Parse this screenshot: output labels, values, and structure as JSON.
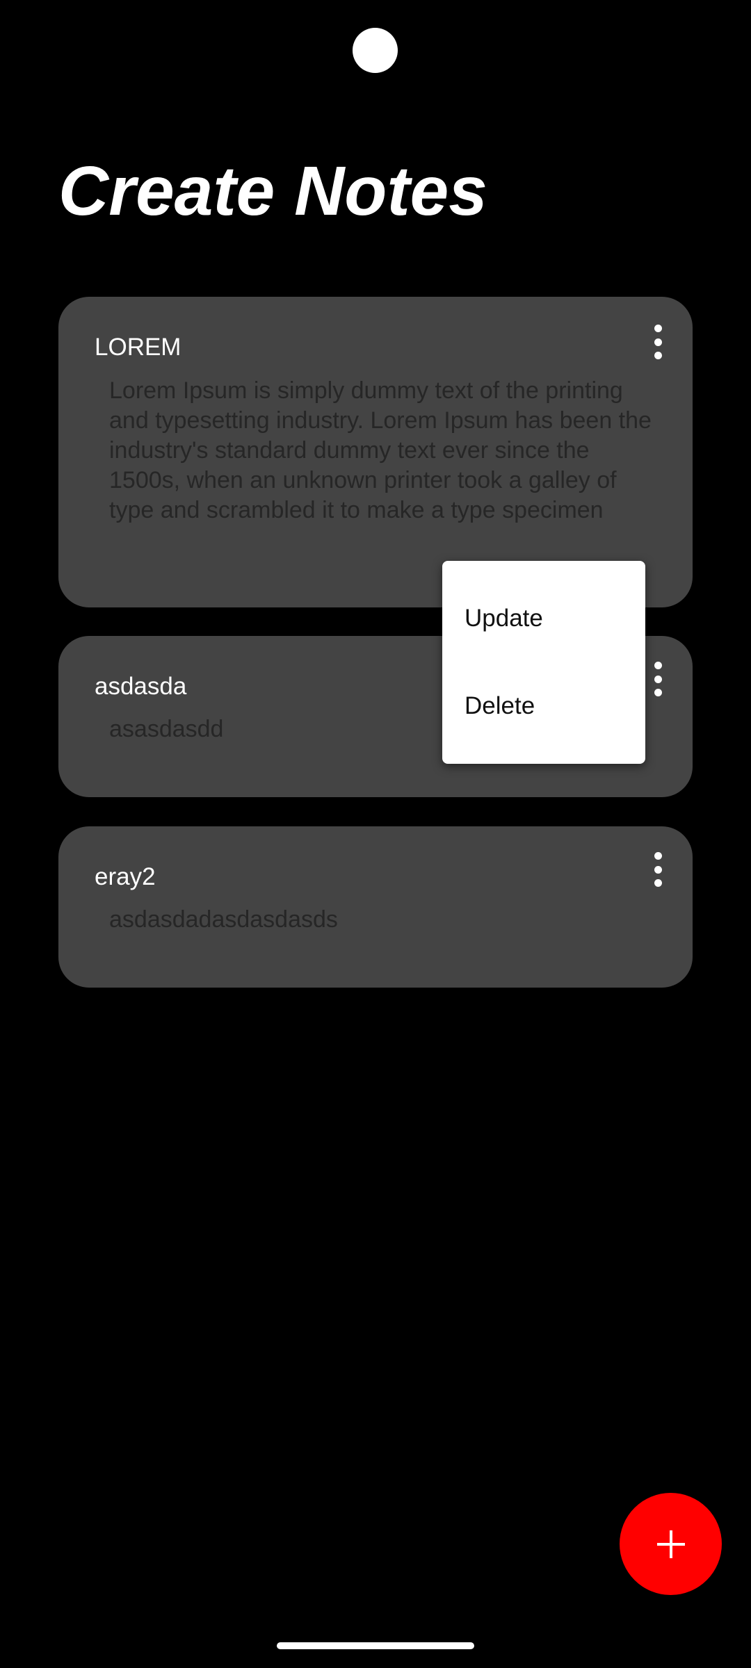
{
  "header": {
    "title": "Create Notes"
  },
  "notes": [
    {
      "title": "LOREM",
      "body": "Lorem Ipsum is simply dummy text of the printing and typesetting industry. Lorem Ipsum has been the industry's standard dummy text ever since the 1500s, when an unknown printer took a galley of type and scrambled it to make a type specimen",
      "menu_icon": "more-vert-icon"
    },
    {
      "title": "asdasda",
      "body": "asasdasdd",
      "menu_icon": "more-vert-icon"
    },
    {
      "title": "eray2",
      "body": "asdasdadasdasdasds",
      "menu_icon": "more-vert-icon"
    }
  ],
  "popup_menu": {
    "items": [
      "Update",
      "Delete"
    ]
  },
  "fab": {
    "icon": "plus-icon",
    "color": "#ff0000"
  },
  "colors": {
    "background": "#000000",
    "card": "#444444",
    "title_text": "#ffffff",
    "body_text": "#262626",
    "menu_bg": "#ffffff"
  }
}
